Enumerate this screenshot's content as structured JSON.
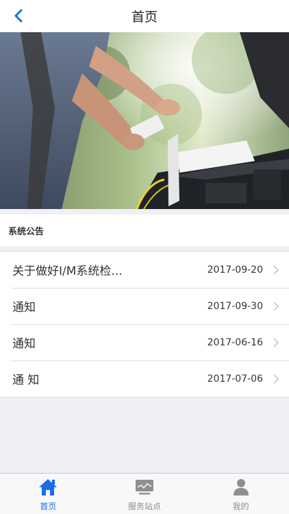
{
  "nav": {
    "title": "首页"
  },
  "announcements": {
    "title": "系统公告",
    "items": [
      {
        "title": "关于做好I/M系统检...",
        "date": "2017-09-20"
      },
      {
        "title": "通知",
        "date": "2017-09-30"
      },
      {
        "title": "通知",
        "date": "2017-06-16"
      },
      {
        "title": "通 知",
        "date": "2017-07-06"
      }
    ]
  },
  "tabbar": {
    "tabs": [
      {
        "label": "首页",
        "icon": "home-icon",
        "active": true
      },
      {
        "label": "服务站点",
        "icon": "monitor-icon",
        "active": false
      },
      {
        "label": "我的",
        "icon": "user-icon",
        "active": false
      }
    ]
  },
  "colors": {
    "accent": "#1a6ce8",
    "inactive": "#8e8e93",
    "background": "#efeff4"
  }
}
